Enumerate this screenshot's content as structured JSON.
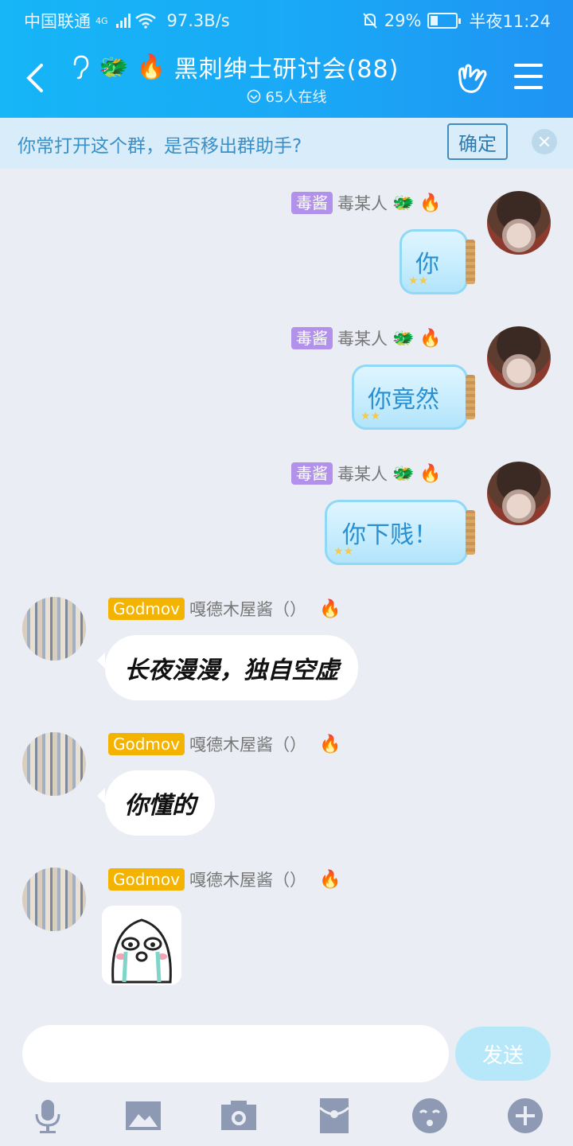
{
  "status_bar": {
    "carrier": "中国联通",
    "network": "4G",
    "speed": "97.3B/s",
    "battery": "29%",
    "time": "半夜11:24"
  },
  "header": {
    "title": "黑刺绅士研讨会(88)",
    "online": "65人在线",
    "badges": [
      "🐲",
      "🔥"
    ]
  },
  "banner": {
    "text": "你常打开这个群，是否移出群助手?",
    "confirm": "确定"
  },
  "messages": [
    {
      "side": "right",
      "tag": "毒酱",
      "name": "毒某人",
      "badges": "🐲 🔥",
      "text": "你"
    },
    {
      "side": "right",
      "tag": "毒酱",
      "name": "毒某人",
      "badges": "🐲 🔥",
      "text": "你竟然"
    },
    {
      "side": "right",
      "tag": "毒酱",
      "name": "毒某人",
      "badges": "🐲 🔥",
      "text": "你下贱！"
    },
    {
      "side": "left",
      "tag": "Godmov",
      "name": "嘎德木屋酱（）",
      "badges": "🔥",
      "text": "长夜漫漫，独自空虚"
    },
    {
      "side": "left",
      "tag": "Godmov",
      "name": "嘎德木屋酱（）",
      "badges": "🔥",
      "text": "你懂的"
    },
    {
      "side": "left",
      "tag": "Godmov",
      "name": "嘎德木屋酱（）",
      "badges": "🔥",
      "text": ""
    }
  ],
  "composer": {
    "placeholder": "",
    "send": "发送"
  },
  "toolbar": [
    "mic-icon",
    "image-icon",
    "camera-icon",
    "redpacket-icon",
    "emoji-icon",
    "plus-icon"
  ],
  "colors": {
    "header": "#1aa8f6",
    "banner": "#d8edf9",
    "jar_text": "#2a8fd1",
    "tag_purple": "#b191e9",
    "tag_gold": "#f4b300"
  }
}
